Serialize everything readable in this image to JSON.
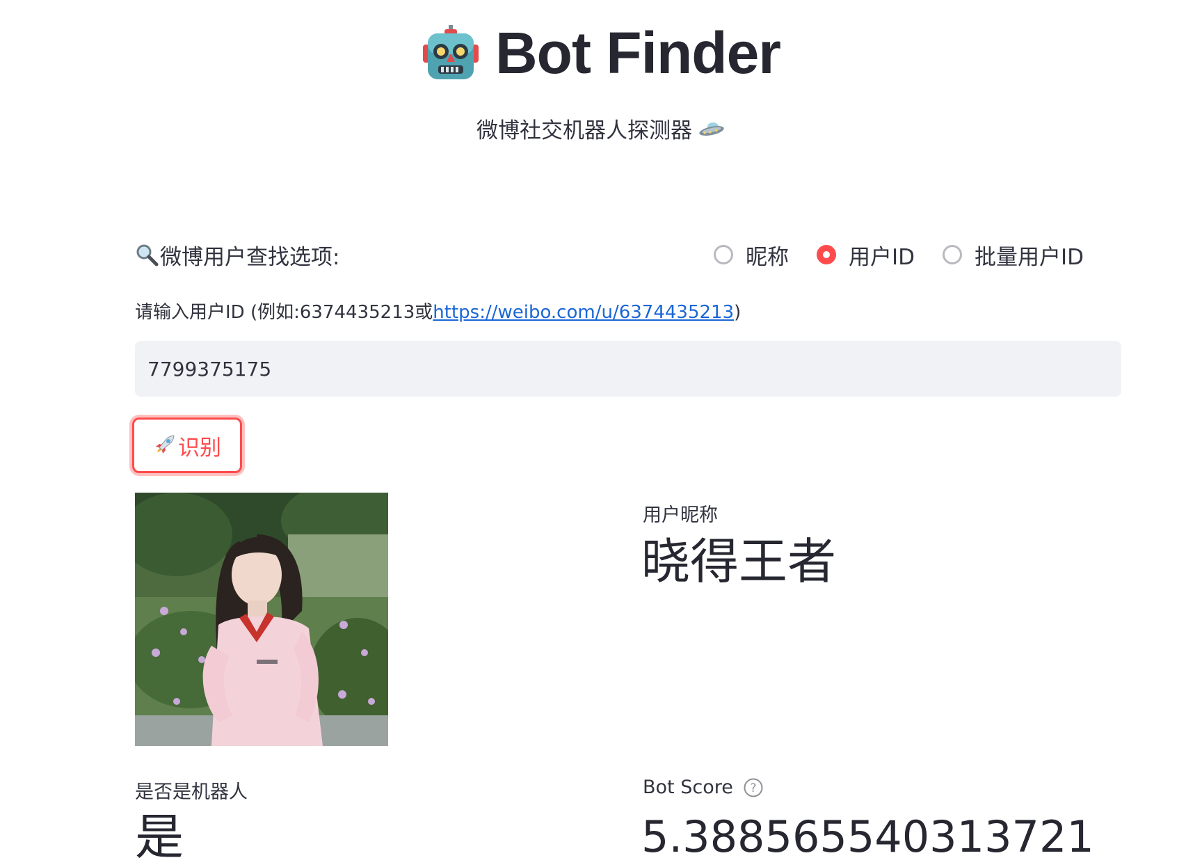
{
  "header": {
    "title": "Bot Finder",
    "subtitle": "微博社交机器人探测器",
    "title_icon": "robot-face-icon",
    "subtitle_icon": "flying-saucer-icon"
  },
  "search_options": {
    "label": "微博用户查找选项:",
    "label_icon": "magnifier-icon",
    "options": [
      "昵称",
      "用户ID",
      "批量用户ID"
    ],
    "selected": "用户ID"
  },
  "user_input": {
    "label_prefix": "请输入用户ID (例如:6374435213或",
    "label_link": "https://weibo.com/u/6374435213",
    "label_suffix": ")",
    "value": "7799375175"
  },
  "run_button": {
    "label": "识别",
    "icon": "rocket-icon"
  },
  "result": {
    "avatar": "user-avatar-photo",
    "nickname_label": "用户昵称",
    "nickname_value": "晓得王者",
    "is_bot_label": "是否是机器人",
    "is_bot_value": "是",
    "bot_score_label": "Bot Score",
    "bot_score_value": "5.388565540313721"
  },
  "colors": {
    "accent": "#ff4b4b",
    "text": "#31333f",
    "input_bg": "#f0f2f6",
    "link": "#1a66d6"
  }
}
